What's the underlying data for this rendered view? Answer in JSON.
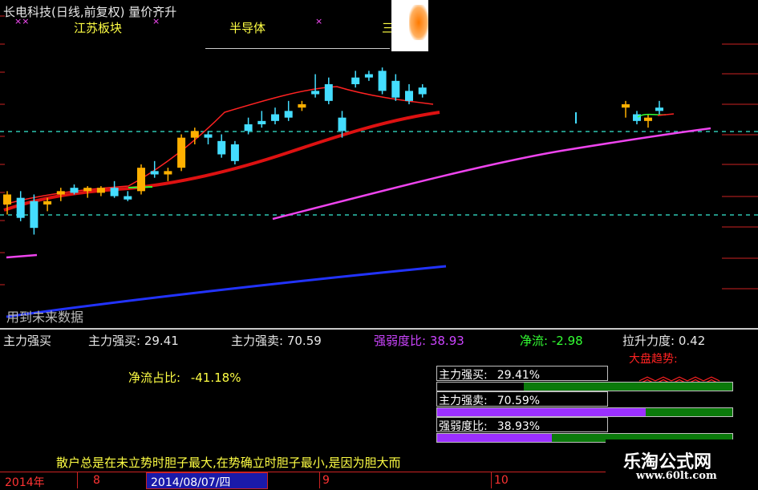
{
  "header": {
    "title": "长电科技(日线,前复权) 量价齐升",
    "sector_1": "江苏板块",
    "sector_2": "半导体",
    "sector_3": "三"
  },
  "watermark_text": "用到未来数据",
  "indicator_row": {
    "name": "主力强买",
    "buy_label": "主力强买:",
    "buy_value": "29.41",
    "sell_label": "主力强卖:",
    "sell_value": "70.59",
    "ratio_label": "强弱度比:",
    "ratio_value": "38.93",
    "net_label": "净流:",
    "net_value": "-2.98",
    "pull_label": "拉升力度:",
    "pull_value": "0.42"
  },
  "net_flow": {
    "label": "净流占比:",
    "value": "-41.18%"
  },
  "trend": {
    "label": "大盘趋势:",
    "glyph": "︽︽︽︽︽"
  },
  "panel": [
    {
      "label": "主力强买:",
      "value": "29.41%",
      "fraction": 0.2941,
      "color": "#000000"
    },
    {
      "label": "主力强卖:",
      "value": "70.59%",
      "fraction": 0.7059,
      "color": "#9b30ff"
    },
    {
      "label": "强弱度比:",
      "value": "38.93%",
      "fraction": 0.3893,
      "color": "#9b30ff"
    }
  ],
  "ticker": "散户总是在未立势时胆子最大,在势确立时胆子最小,是因为胆大而",
  "site": {
    "name": "乐淘公式网",
    "url": "www.60lt.com"
  },
  "timeline": {
    "year": "2014年",
    "m1": "8",
    "date": "2014/08/07/四",
    "m2": "9",
    "m3": "10"
  },
  "colors": {
    "up": "#ffb000",
    "down": "#44ddff",
    "ma_short": "#ff2222",
    "ma_long": "#ff44ff",
    "volume_line": "#2244ff"
  },
  "chart_data": {
    "type": "candlestick",
    "candles": [
      {
        "o": 12.2,
        "h": 12.6,
        "l": 11.9,
        "c": 12.5
      },
      {
        "o": 12.4,
        "h": 12.6,
        "l": 11.7,
        "c": 11.8
      },
      {
        "o": 12.3,
        "h": 12.5,
        "l": 11.3,
        "c": 11.5
      },
      {
        "o": 12.2,
        "h": 12.4,
        "l": 12.0,
        "c": 12.3
      },
      {
        "o": 12.5,
        "h": 12.7,
        "l": 12.3,
        "c": 12.6
      },
      {
        "o": 12.7,
        "h": 12.8,
        "l": 12.5,
        "c": 12.55
      },
      {
        "o": 12.6,
        "h": 12.75,
        "l": 12.4,
        "c": 12.7
      },
      {
        "o": 12.55,
        "h": 12.75,
        "l": 12.45,
        "c": 12.7
      },
      {
        "o": 12.7,
        "h": 12.9,
        "l": 12.4,
        "c": 12.45
      },
      {
        "o": 12.45,
        "h": 12.6,
        "l": 12.3,
        "c": 12.35
      },
      {
        "o": 12.6,
        "h": 13.4,
        "l": 12.5,
        "c": 13.3
      },
      {
        "o": 13.2,
        "h": 13.5,
        "l": 13.0,
        "c": 13.1
      },
      {
        "o": 13.1,
        "h": 13.3,
        "l": 12.9,
        "c": 13.2
      },
      {
        "o": 13.3,
        "h": 14.3,
        "l": 13.2,
        "c": 14.2
      },
      {
        "o": 14.2,
        "h": 14.5,
        "l": 14.0,
        "c": 14.4
      },
      {
        "o": 14.3,
        "h": 14.4,
        "l": 14.0,
        "c": 14.2
      },
      {
        "o": 14.1,
        "h": 14.3,
        "l": 13.6,
        "c": 13.7
      },
      {
        "o": 14.0,
        "h": 14.1,
        "l": 13.4,
        "c": 13.5
      },
      {
        "o": 14.6,
        "h": 14.8,
        "l": 14.3,
        "c": 14.4
      },
      {
        "o": 14.7,
        "h": 15.0,
        "l": 14.5,
        "c": 14.6
      },
      {
        "o": 14.9,
        "h": 15.1,
        "l": 14.6,
        "c": 14.7
      },
      {
        "o": 15.0,
        "h": 15.3,
        "l": 14.7,
        "c": 14.8
      },
      {
        "o": 15.1,
        "h": 15.3,
        "l": 15.0,
        "c": 15.2
      },
      {
        "o": 15.6,
        "h": 16.1,
        "l": 15.4,
        "c": 15.5
      },
      {
        "o": 15.8,
        "h": 16.0,
        "l": 15.2,
        "c": 15.3
      },
      {
        "o": 14.8,
        "h": 15.0,
        "l": 14.2,
        "c": 14.4
      },
      {
        "o": 16.0,
        "h": 16.2,
        "l": 15.7,
        "c": 15.8
      },
      {
        "o": 16.1,
        "h": 16.2,
        "l": 15.9,
        "c": 16.0
      },
      {
        "o": 16.2,
        "h": 16.3,
        "l": 15.5,
        "c": 15.6
      },
      {
        "o": 15.9,
        "h": 16.1,
        "l": 15.3,
        "c": 15.4
      },
      {
        "o": 15.6,
        "h": 15.8,
        "l": 15.2,
        "c": 15.3
      },
      {
        "o": 15.7,
        "h": 15.8,
        "l": 15.4,
        "c": 15.5
      }
    ],
    "candles_right": [
      {
        "o": 15.1,
        "h": 15.3,
        "l": 14.8,
        "c": 15.2
      },
      {
        "o": 14.9,
        "h": 15.0,
        "l": 14.6,
        "c": 14.7
      },
      {
        "o": 14.7,
        "h": 14.9,
        "l": 14.5,
        "c": 14.8
      },
      {
        "o": 15.1,
        "h": 15.3,
        "l": 14.9,
        "c": 15.0
      }
    ],
    "ylim": [
      11.0,
      17.0
    ]
  }
}
